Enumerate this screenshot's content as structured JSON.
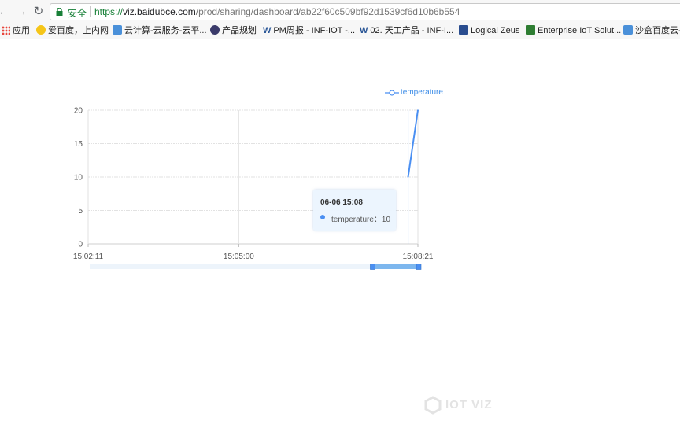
{
  "browser": {
    "secure_label": "安全",
    "url_scheme": "https://",
    "url_host": "viz.baidubce.com",
    "url_path": "/prod/sharing/dashboard/ab22f60c509bf92d1539cf6d10b6b554"
  },
  "bookmarks": [
    {
      "label": "应用",
      "icon": "apps-grid-icon"
    },
    {
      "label": "爱百度，上内网",
      "icon": "smiley-icon",
      "color": "#f5c518"
    },
    {
      "label": "云计算-云服务-云平...",
      "icon": "hexagon-icon",
      "color": "#4a90d9"
    },
    {
      "label": "产品规划",
      "icon": "globe-icon",
      "color": "#3a3a6a"
    },
    {
      "label": "PM周报 - INF-IOT -...",
      "icon": "w-doc-icon",
      "color": "#2b5797"
    },
    {
      "label": "02. 天工产品 - INF-I...",
      "icon": "w-doc-icon",
      "color": "#2b5797"
    },
    {
      "label": "Logical Zeus",
      "icon": "paw-icon",
      "color": "#2a4d8f"
    },
    {
      "label": "Enterprise IoT Solut...",
      "icon": "layers-icon",
      "color": "#2e7d32"
    },
    {
      "label": "沙盒百度云-...",
      "icon": "hexagon-icon",
      "color": "#4a90d9"
    }
  ],
  "chart_data": {
    "type": "line",
    "legend_position": "top-right",
    "series": [
      {
        "name": "temperature",
        "color": "#4a8ff2",
        "points": [
          {
            "x": "15:08:10",
            "y": 10
          },
          {
            "x": "15:08:21",
            "y": 20
          }
        ]
      }
    ],
    "x_ticks": [
      "15:02:11",
      "15:05:00",
      "15:08:21"
    ],
    "y_ticks": [
      "0",
      "5",
      "10",
      "15",
      "20"
    ],
    "ylim": [
      0,
      20
    ],
    "grid": true,
    "tooltip": {
      "title": "06-06 15:08",
      "series": "temperature",
      "sep": "：",
      "value": "10"
    },
    "data_zoom": {
      "start": 0.86,
      "end": 1.0
    }
  },
  "watermark": "IOT VIZ"
}
